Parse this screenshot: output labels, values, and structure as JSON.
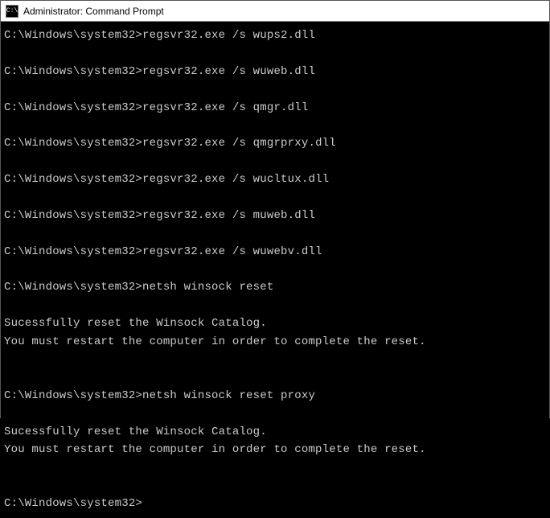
{
  "titlebar": {
    "icon_label": "C:\\",
    "title": "Administrator: Command Prompt"
  },
  "prompt": "C:\\Windows\\system32>",
  "lines": [
    {
      "type": "cmd",
      "text": "regsvr32.exe /s wups2.dll"
    },
    {
      "type": "blank"
    },
    {
      "type": "cmd",
      "text": "regsvr32.exe /s wuweb.dll"
    },
    {
      "type": "blank"
    },
    {
      "type": "cmd",
      "text": "regsvr32.exe /s qmgr.dll"
    },
    {
      "type": "blank"
    },
    {
      "type": "cmd",
      "text": "regsvr32.exe /s qmgrprxy.dll"
    },
    {
      "type": "blank"
    },
    {
      "type": "cmd",
      "text": "regsvr32.exe /s wucltux.dll"
    },
    {
      "type": "blank"
    },
    {
      "type": "cmd",
      "text": "regsvr32.exe /s muweb.dll"
    },
    {
      "type": "blank"
    },
    {
      "type": "cmd",
      "text": "regsvr32.exe /s wuwebv.dll"
    },
    {
      "type": "blank"
    },
    {
      "type": "cmd",
      "text": "netsh winsock reset"
    },
    {
      "type": "blank"
    },
    {
      "type": "out",
      "text": "Sucessfully reset the Winsock Catalog."
    },
    {
      "type": "out",
      "text": "You must restart the computer in order to complete the reset."
    },
    {
      "type": "blank"
    },
    {
      "type": "blank"
    },
    {
      "type": "cmd",
      "text": "netsh winsock reset proxy"
    },
    {
      "type": "blank"
    },
    {
      "type": "out",
      "text": "Sucessfully reset the Winsock Catalog."
    },
    {
      "type": "out",
      "text": "You must restart the computer in order to complete the reset."
    },
    {
      "type": "blank"
    },
    {
      "type": "blank"
    },
    {
      "type": "cmd",
      "text": ""
    }
  ]
}
